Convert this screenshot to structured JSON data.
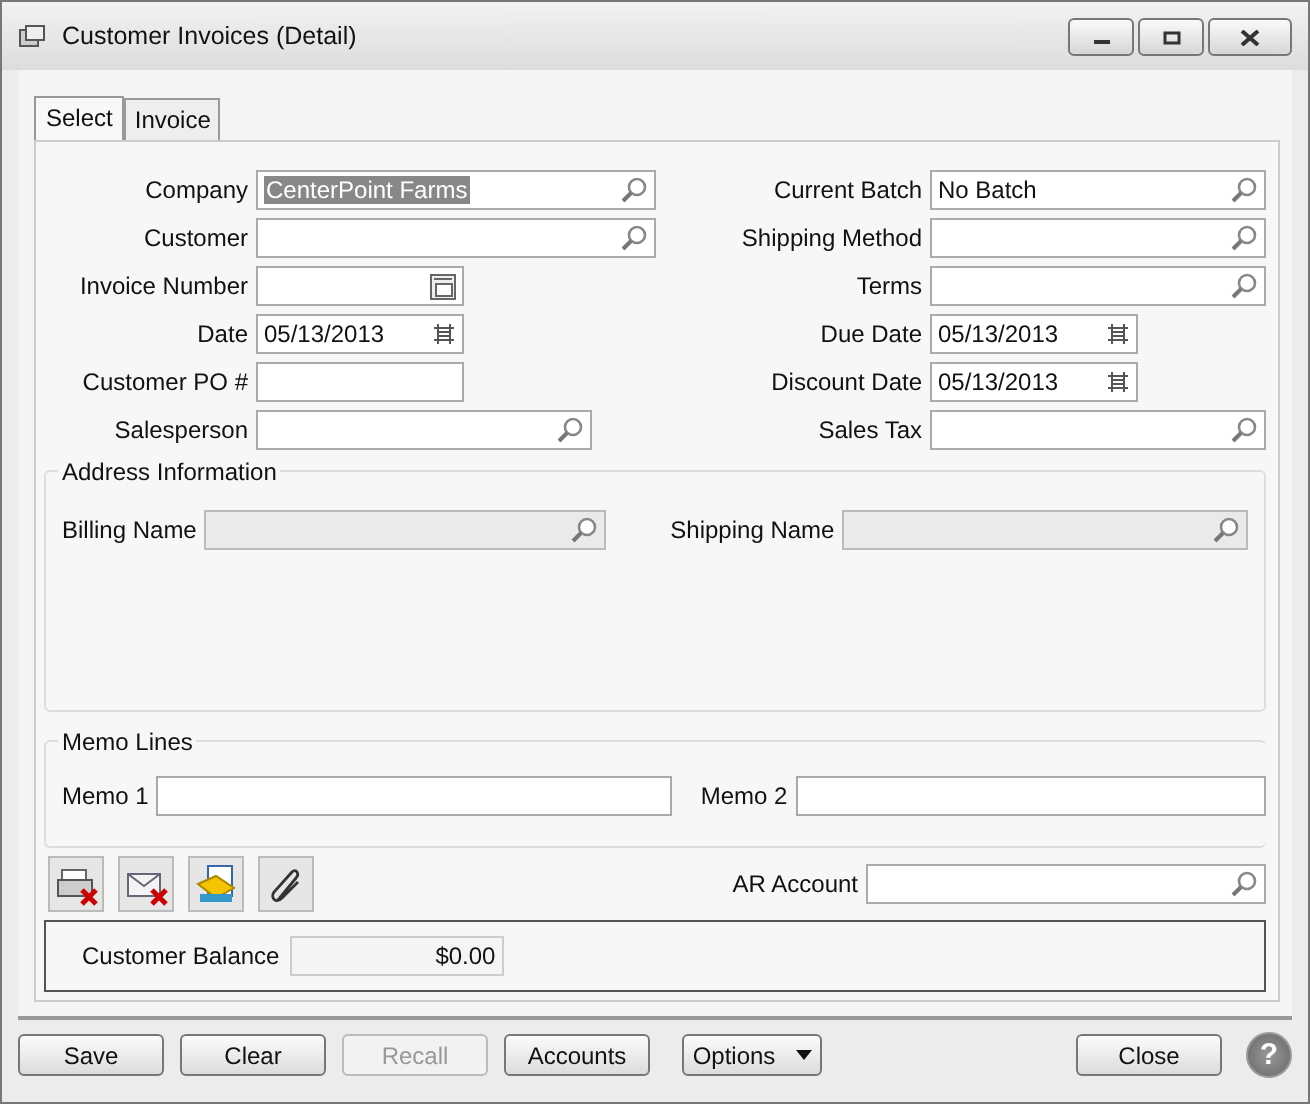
{
  "window": {
    "title": "Customer Invoices (Detail)"
  },
  "tabs": [
    {
      "label": "Select",
      "selected": true
    },
    {
      "label": "Invoice",
      "selected": false
    }
  ],
  "form": {
    "left": [
      {
        "label": "Company",
        "kind": "lookup",
        "value": "CenterPoint Farms",
        "highlighted": true,
        "disabled": false
      },
      {
        "label": "Customer",
        "kind": "lookup",
        "disabled": false
      },
      {
        "label": "Invoice Number",
        "kind": "number",
        "disabled": false
      },
      {
        "label": "Date",
        "kind": "date",
        "value": "05/13/2013",
        "highlighted": false,
        "disabled": false
      },
      {
        "label": "Customer PO #",
        "kind": "text",
        "disabled": false
      },
      {
        "label": "Salesperson",
        "kind": "lookup",
        "disabled": false
      }
    ],
    "right": [
      {
        "label": "Current Batch",
        "kind": "lookup",
        "value": "No Batch",
        "highlighted": false,
        "disabled": false
      },
      {
        "label": "Shipping Method",
        "kind": "lookup",
        "disabled": false
      },
      {
        "label": "Terms",
        "kind": "lookup",
        "disabled": false
      },
      {
        "label": "Due Date",
        "kind": "date",
        "value": "05/13/2013",
        "highlighted": false,
        "disabled": false
      },
      {
        "label": "Discount Date",
        "kind": "date",
        "value": "05/13/2013",
        "highlighted": false,
        "disabled": false
      },
      {
        "label": "Sales Tax",
        "kind": "lookup",
        "disabled": false
      }
    ]
  },
  "address": {
    "title": "Address Information",
    "fields": [
      {
        "label": "Billing Name",
        "kind": "lookup",
        "disabled": true
      },
      {
        "label": "Shipping Name",
        "kind": "lookup",
        "disabled": true
      }
    ]
  },
  "memo": {
    "title": "Memo Lines",
    "fields": [
      {
        "label": "Memo 1",
        "disabled": false
      },
      {
        "label": "Memo 2",
        "disabled": false
      }
    ]
  },
  "tools": [
    {
      "kind": "printer-cross"
    },
    {
      "kind": "envelope-cross"
    },
    {
      "kind": "documents"
    },
    {
      "kind": "paperclip"
    }
  ],
  "ar_account": {
    "label": "AR Account",
    "kind": "lookup",
    "disabled": false
  },
  "balance": {
    "label": "Customer Balance",
    "value": "$0.00"
  },
  "buttons": [
    {
      "label": "Save",
      "kind": "plain",
      "disabled": false
    },
    {
      "label": "Clear",
      "kind": "plain",
      "disabled": false
    },
    {
      "label": "Recall",
      "kind": "plain",
      "disabled": true
    },
    {
      "label": "Accounts",
      "kind": "plain",
      "disabled": false
    },
    {
      "label": "Options",
      "kind": "menu",
      "disabled": false
    }
  ],
  "right_buttons": [
    {
      "label": "Close",
      "kind": "plain",
      "disabled": false
    }
  ],
  "help": {
    "glyph": "?"
  }
}
